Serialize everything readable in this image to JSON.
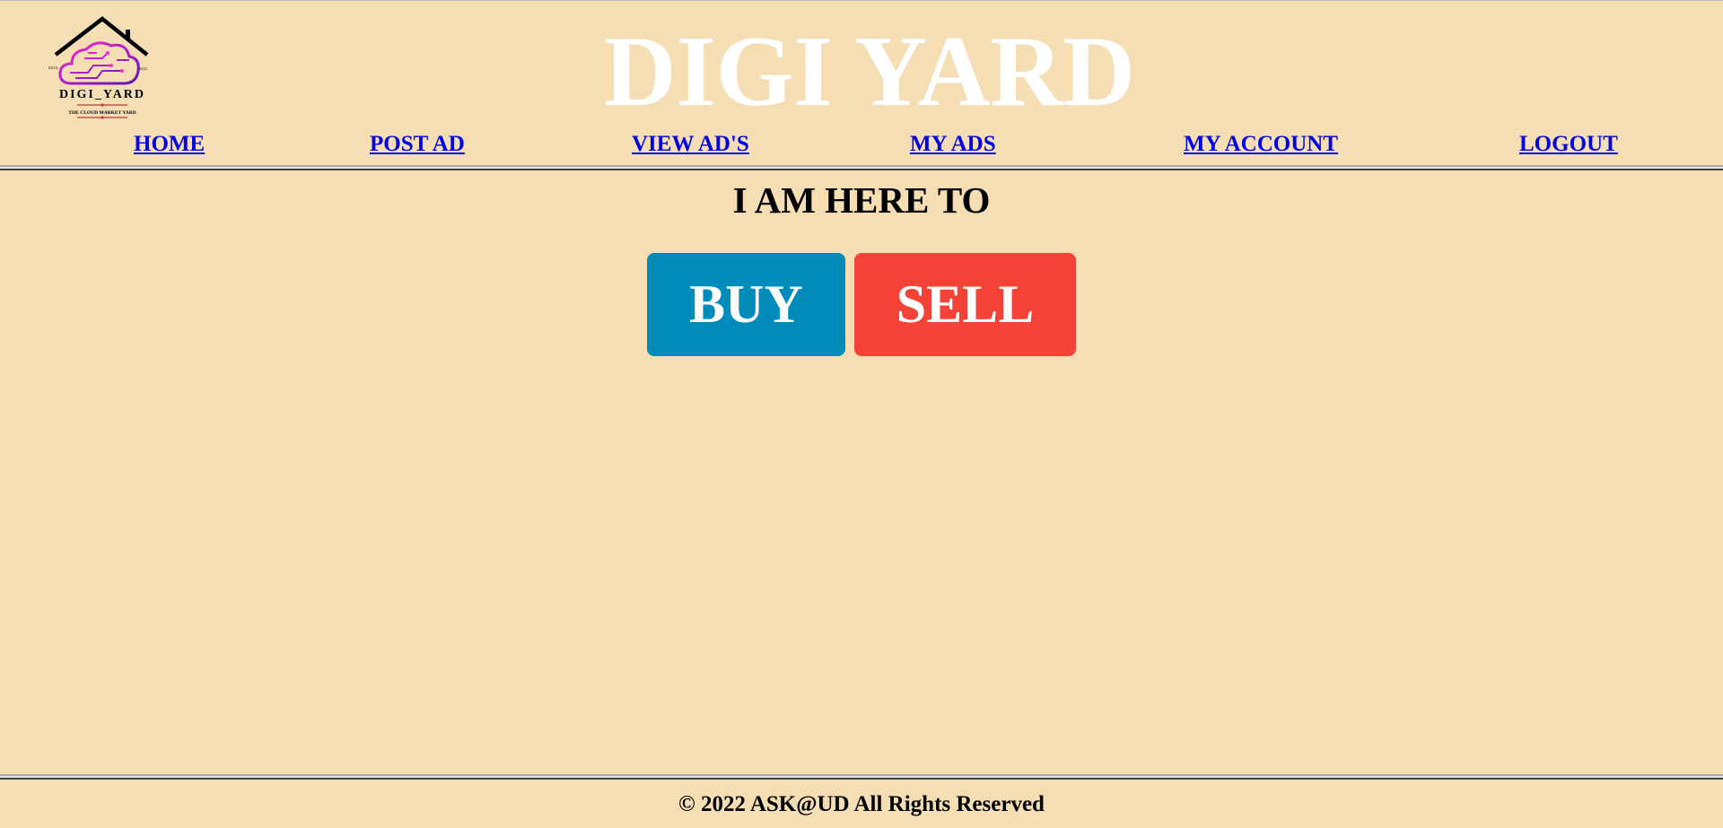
{
  "logo": {
    "name": "DIGI_YARD",
    "estd_left": "ESTD",
    "estd_right": "2022",
    "tagline": "THE CLOUD MARKET YARD"
  },
  "site_title": "DIGI YARD",
  "nav": {
    "items": [
      {
        "label": "HOME"
      },
      {
        "label": "POST AD"
      },
      {
        "label": "VIEW AD'S"
      },
      {
        "label": "MY ADS"
      },
      {
        "label": "MY ACCOUNT"
      },
      {
        "label": "LOGOUT"
      }
    ]
  },
  "main": {
    "heading": "I AM HERE TO",
    "buy_label": "BUY",
    "sell_label": "SELL"
  },
  "footer": {
    "text": "© 2022 ASK@UD All Rights Reserved"
  },
  "colors": {
    "background": "#f5deb3",
    "buy": "#008cba",
    "sell": "#f44336",
    "link": "#0000ee"
  }
}
